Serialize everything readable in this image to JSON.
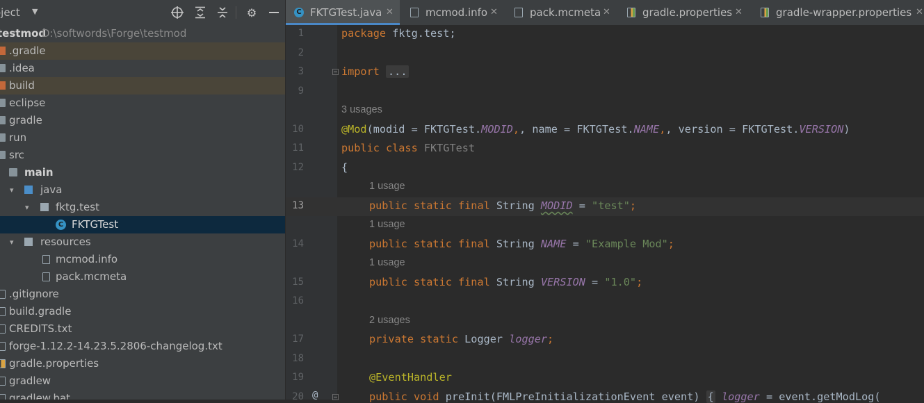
{
  "project_panel": {
    "title": "oject",
    "tree": [
      {
        "label": "testmod",
        "path": "D:\\softwords\\Forge\\testmod"
      },
      {
        "label": ".gradle"
      },
      {
        "label": ".idea"
      },
      {
        "label": "build"
      },
      {
        "label": "eclipse"
      },
      {
        "label": "gradle"
      },
      {
        "label": "run"
      },
      {
        "label": "src"
      },
      {
        "label": "main"
      },
      {
        "label": "java"
      },
      {
        "label": "fktg.test"
      },
      {
        "label": "FKTGTest"
      },
      {
        "label": "resources"
      },
      {
        "label": "mcmod.info"
      },
      {
        "label": "pack.mcmeta"
      },
      {
        "label": ".gitignore"
      },
      {
        "label": "build.gradle"
      },
      {
        "label": "CREDITS.txt"
      },
      {
        "label": "forge-1.12.2-14.23.5.2806-changelog.txt"
      },
      {
        "label": "gradle.properties"
      },
      {
        "label": "gradlew"
      },
      {
        "label": "gradlew.bat"
      }
    ]
  },
  "tabs": [
    {
      "label": "FKTGTest.java",
      "icon": "java-class-icon",
      "active": true
    },
    {
      "label": "mcmod.info",
      "icon": "file-icon"
    },
    {
      "label": "pack.mcmeta",
      "icon": "file-icon"
    },
    {
      "label": "gradle.properties",
      "icon": "properties-icon"
    },
    {
      "label": "gradle-wrapper.properties",
      "icon": "properties-icon"
    }
  ],
  "editor": {
    "line_numbers": [
      "1",
      "2",
      "3",
      "9",
      "10",
      "11",
      "12",
      "13",
      "14",
      "15",
      "16",
      "17",
      "18",
      "19",
      "20"
    ],
    "current_line": "13",
    "hints": [
      "3 usages",
      "1 usage",
      "1 usage",
      "1 usage",
      "2 usages"
    ],
    "code": {
      "l1_kw": "package",
      "l1_rest": " fktg.test;",
      "l3_kw": "import",
      "l3_fold": "...",
      "l10_ann": "@Mod",
      "l10_a": "(modid = FKTGTest.",
      "l10_f1": "MODID",
      "l10_b": ", name = FKTGTest.",
      "l10_f2": "NAME",
      "l10_c": ", version = FKTGTest.",
      "l10_f3": "VERSION",
      "l10_d": ")",
      "l11_kw": "public class",
      "l11_name": " FKTGTest",
      "l12": "{",
      "l13_kw": "public static final",
      "l13_type": " String ",
      "l13_f": "MODID",
      "l13_eq": " = ",
      "l13_s": "\"test\"",
      "l13_end": ";",
      "l14_kw": "public static final",
      "l14_type": " String ",
      "l14_f": "NAME",
      "l14_eq": " = ",
      "l14_s": "\"Example Mod\"",
      "l14_end": ";",
      "l15_kw": "public static final",
      "l15_type": " String ",
      "l15_f": "VERSION",
      "l15_eq": " = ",
      "l15_s": "\"1.0\"",
      "l15_end": ";",
      "l17_kw": "private static",
      "l17_type": " Logger ",
      "l17_f": "logger",
      "l17_end": ";",
      "l19_ann": "@EventHandler",
      "l20_kw": "public void",
      "l20_a": " preInit(FMLPreInitializationEvent event) ",
      "l20_brace": "{",
      "l20_f": " logger",
      "l20_b": " = event.getModLog("
    }
  },
  "colors": {
    "keyword": "#cc7832",
    "annotation": "#bbb529",
    "field": "#9876aa",
    "string": "#6a8759",
    "text": "#a9b7c6",
    "selection": "#0d293e",
    "accent": "#4a88c7"
  }
}
